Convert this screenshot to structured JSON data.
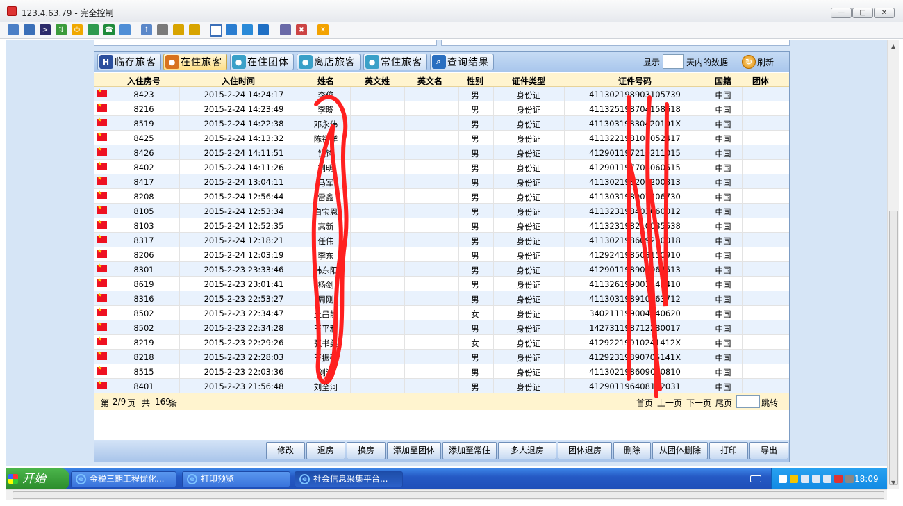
{
  "window": {
    "title": "123.4.63.79 - 完全控制"
  },
  "tabs": [
    {
      "label": "临存旅客",
      "icon": "hotel-icon",
      "active": false
    },
    {
      "label": "在住旅客",
      "icon": "guest-icon",
      "active": true
    },
    {
      "label": "在住团体",
      "icon": "group-icon",
      "active": false
    },
    {
      "label": "离店旅客",
      "icon": "checkout-icon",
      "active": false
    },
    {
      "label": "常住旅客",
      "icon": "resident-icon",
      "active": false
    },
    {
      "label": "查询结果",
      "icon": "search-icon",
      "active": false
    }
  ],
  "filter": {
    "prefix": "显示",
    "suffix": "天内的数据",
    "value": ""
  },
  "refresh_label": "刷新",
  "columns": [
    "入住房号",
    "入住时间",
    "姓名",
    "英文姓",
    "英文名",
    "性别",
    "证件类型",
    "证件号码",
    "国籍",
    "团体"
  ],
  "rows": [
    {
      "room": "8423",
      "time": "2015-2-24 14:24:17",
      "name": "李俊",
      "sex": "男",
      "idtype": "身份证",
      "idno": "411302198903105739",
      "nation": "中国"
    },
    {
      "room": "8216",
      "time": "2015-2-24 14:23:49",
      "name": "李晓",
      "sex": "男",
      "idtype": "身份证",
      "idno": "411325198704158618",
      "nation": "中国"
    },
    {
      "room": "8519",
      "time": "2015-2-24 14:22:38",
      "name": "邓永伟",
      "sex": "男",
      "idtype": "身份证",
      "idno": "41130319830420101X",
      "nation": "中国"
    },
    {
      "room": "8425",
      "time": "2015-2-24 14:13:32",
      "name": "陈福洋",
      "sex": "男",
      "idtype": "身份证",
      "idno": "411322198105052417",
      "nation": "中国"
    },
    {
      "room": "8426",
      "time": "2015-2-24 14:11:51",
      "name": "钱锋",
      "sex": "男",
      "idtype": "身份证",
      "idno": "412901197210211015",
      "nation": "中国"
    },
    {
      "room": "8402",
      "time": "2015-2-24 14:11:26",
      "name": "刘明",
      "sex": "男",
      "idtype": "身份证",
      "idno": "412901197708060515",
      "nation": "中国"
    },
    {
      "room": "8417",
      "time": "2015-2-24 13:04:11",
      "name": "马军",
      "sex": "男",
      "idtype": "身份证",
      "idno": "411302198206200813",
      "nation": "中国"
    },
    {
      "room": "8208",
      "time": "2015-2-24 12:56:44",
      "name": "雷鑫",
      "sex": "男",
      "idtype": "身份证",
      "idno": "411303198907206730",
      "nation": "中国"
    },
    {
      "room": "8105",
      "time": "2015-2-24 12:53:34",
      "name": "白宝恩",
      "sex": "男",
      "idtype": "身份证",
      "idno": "411323198403060012",
      "nation": "中国"
    },
    {
      "room": "8103",
      "time": "2015-2-24 12:52:35",
      "name": "高新",
      "sex": "男",
      "idtype": "身份证",
      "idno": "411323198210085538",
      "nation": "中国"
    },
    {
      "room": "8317",
      "time": "2015-2-24 12:18:21",
      "name": "任伟",
      "sex": "男",
      "idtype": "身份证",
      "idno": "411302198609200018",
      "nation": "中国"
    },
    {
      "room": "8206",
      "time": "2015-2-24 12:03:19",
      "name": "李东",
      "sex": "男",
      "idtype": "身份证",
      "idno": "412924198503150910",
      "nation": "中国"
    },
    {
      "room": "8301",
      "time": "2015-2-23 23:33:46",
      "name": "韩东阳",
      "sex": "男",
      "idtype": "身份证",
      "idno": "412901198904064513",
      "nation": "中国"
    },
    {
      "room": "8619",
      "time": "2015-2-23 23:01:41",
      "name": "杨剑",
      "sex": "男",
      "idtype": "身份证",
      "idno": "411326199001142410",
      "nation": "中国"
    },
    {
      "room": "8316",
      "time": "2015-2-23 22:53:27",
      "name": "周刚",
      "sex": "男",
      "idtype": "身份证",
      "idno": "411303198910063712",
      "nation": "中国"
    },
    {
      "room": "8502",
      "time": "2015-2-23 22:34:47",
      "name": "王昌静",
      "sex": "女",
      "idtype": "身份证",
      "idno": "340211199004140620",
      "nation": "中国"
    },
    {
      "room": "8502",
      "time": "2015-2-23 22:34:28",
      "name": "王平利",
      "sex": "男",
      "idtype": "身份证",
      "idno": "142731198712280017",
      "nation": "中国"
    },
    {
      "room": "8219",
      "time": "2015-2-23 22:29:26",
      "name": "张书美",
      "sex": "女",
      "idtype": "身份证",
      "idno": "41292219910241412X",
      "nation": "中国"
    },
    {
      "room": "8218",
      "time": "2015-2-23 22:28:03",
      "name": "王振强",
      "sex": "男",
      "idtype": "身份证",
      "idno": "41292319890705141X",
      "nation": "中国"
    },
    {
      "room": "8515",
      "time": "2015-2-23 22:03:36",
      "name": "刘洋",
      "sex": "男",
      "idtype": "身份证",
      "idno": "411302198609010810",
      "nation": "中国"
    },
    {
      "room": "8401",
      "time": "2015-2-23 21:56:48",
      "name": "刘全河",
      "sex": "男",
      "idtype": "身份证",
      "idno": "412901196408112031",
      "nation": "中国"
    }
  ],
  "pager": {
    "page_prefix": "第",
    "page_value": "2/9",
    "page_suffix": "页",
    "total_prefix": "共",
    "total_value": "169",
    "total_suffix": "条",
    "first": "首页",
    "prev": "上一页",
    "next": "下一页",
    "last": "尾页",
    "jump": "跳转"
  },
  "actions": [
    "修改",
    "退房",
    "换房",
    "添加至团体",
    "添加至常住",
    "多人退房",
    "团体退房",
    "删除",
    "从团体删除",
    "打印",
    "导出"
  ],
  "taskbar": {
    "start": "开始",
    "tasks": [
      "金税三期工程优化...",
      "打印预览",
      "社会信息采集平台..."
    ],
    "clock": "18:09"
  },
  "colors": {
    "accent": "#7c9cc4",
    "header_bg": "#fff4cf",
    "scrawl": "#ff2020"
  }
}
